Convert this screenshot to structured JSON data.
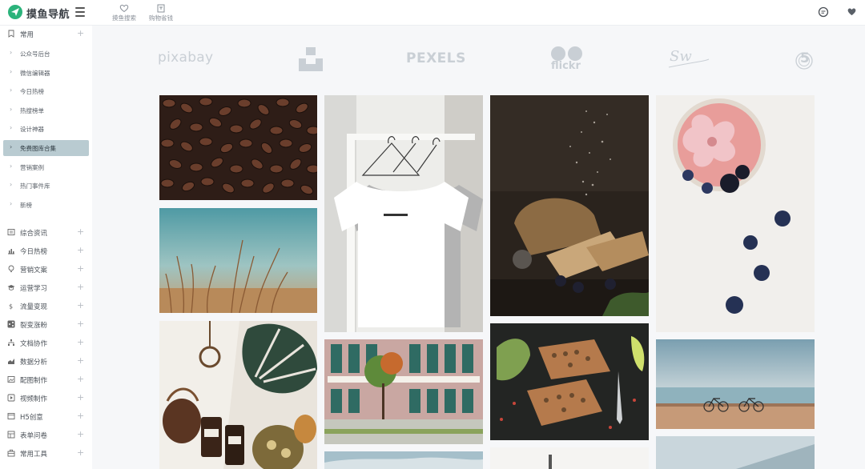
{
  "header": {
    "brand": "摸鱼导航",
    "nav": [
      {
        "label": "摸鱼搜索",
        "icon": "heart-outline-icon"
      },
      {
        "label": "购物省钱",
        "icon": "bag-icon"
      }
    ],
    "right_icons": [
      "chat-icon",
      "heart-icon"
    ]
  },
  "sidebar": {
    "top_group": {
      "label": "常用",
      "icon": "bookmark-icon"
    },
    "sub_items": [
      {
        "label": "公众号后台"
      },
      {
        "label": "微信编辑器"
      },
      {
        "label": "今日热榜"
      },
      {
        "label": "热搜榜单"
      },
      {
        "label": "设计神器"
      },
      {
        "label": "免费图库合集",
        "active": true
      },
      {
        "label": "营销案例"
      },
      {
        "label": "热门事件库"
      },
      {
        "label": "新榜"
      }
    ],
    "groups": [
      {
        "label": "综合资讯",
        "icon": "news-icon"
      },
      {
        "label": "今日热榜",
        "icon": "bar-chart-icon"
      },
      {
        "label": "营销文案",
        "icon": "bulb-icon"
      },
      {
        "label": "运营学习",
        "icon": "graduation-cap-icon"
      },
      {
        "label": "流量变现",
        "icon": "money-icon"
      },
      {
        "label": "裂变涨粉",
        "icon": "share-icon"
      },
      {
        "label": "文档协作",
        "icon": "sitemap-icon"
      },
      {
        "label": "数据分析",
        "icon": "area-chart-icon"
      },
      {
        "label": "配图制作",
        "icon": "image-icon"
      },
      {
        "label": "视频制作",
        "icon": "play-icon"
      },
      {
        "label": "H5创意",
        "icon": "h5-icon"
      },
      {
        "label": "表单问卷",
        "icon": "form-icon"
      },
      {
        "label": "常用工具",
        "icon": "toolbox-icon"
      }
    ]
  },
  "logos": [
    {
      "name": "pixabay",
      "text": "pixabay"
    },
    {
      "name": "unsplash",
      "text": ""
    },
    {
      "name": "pexels",
      "text": "PEXELS"
    },
    {
      "name": "flickr",
      "text": "flickr"
    },
    {
      "name": "stocksnap",
      "text": "Sw"
    },
    {
      "name": "500px",
      "text": "5"
    }
  ],
  "photos": [
    {
      "subject": "coffee-beans"
    },
    {
      "subject": "grass-field"
    },
    {
      "subject": "plants-and-pottery"
    },
    {
      "subject": "white-tshirts-on-hangers"
    },
    {
      "subject": "building-facade"
    },
    {
      "subject": "bread-with-flour"
    },
    {
      "subject": "food-platter"
    },
    {
      "subject": "fruit-bowl-with-flower"
    },
    {
      "subject": "bikes-by-sea"
    }
  ],
  "colors": {
    "accent": "#2bb37b",
    "active_item": "#b9cbd1",
    "logo_gray": "#c9cfd5"
  }
}
